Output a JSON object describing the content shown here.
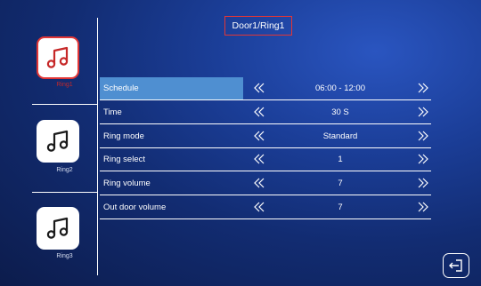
{
  "header": {
    "title": "Door1/Ring1"
  },
  "sidebar": {
    "items": [
      {
        "label": "Ring1",
        "icon": "music-note-icon",
        "active": true
      },
      {
        "label": "Ring2",
        "icon": "music-note-icon",
        "active": false
      },
      {
        "label": "Ring3",
        "icon": "music-note-icon",
        "active": false
      }
    ]
  },
  "settings": {
    "rows": [
      {
        "label": "Schedule",
        "value": "06:00 - 12:00",
        "selected": true
      },
      {
        "label": "Time",
        "value": "30 S",
        "selected": false
      },
      {
        "label": "Ring mode",
        "value": "Standard",
        "selected": false
      },
      {
        "label": "Ring select",
        "value": "1",
        "selected": false
      },
      {
        "label": "Ring volume",
        "value": "7",
        "selected": false
      },
      {
        "label": "Out door volume",
        "value": "7",
        "selected": false
      }
    ]
  },
  "footer": {
    "exit_icon": "exit-icon"
  },
  "colors": {
    "accent_red": "#e23636",
    "selected_row": "#4f8fd1",
    "background": "#1b3e98"
  }
}
